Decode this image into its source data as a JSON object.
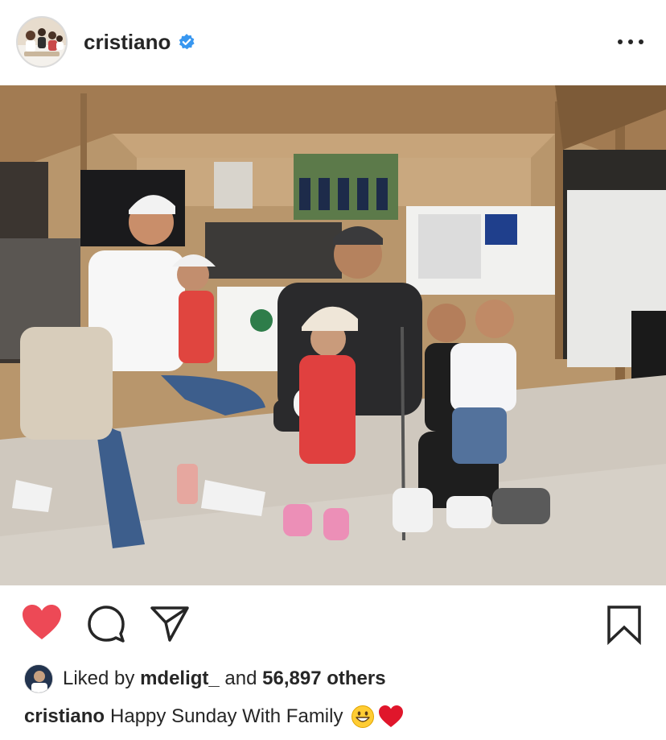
{
  "post": {
    "username": "cristiano",
    "verified": true,
    "icons": {
      "more": "more-horizontal-icon",
      "like": "heart-icon",
      "comment": "comment-bubble-icon",
      "share": "paper-plane-icon",
      "save": "bookmark-icon"
    },
    "liked": true,
    "colors": {
      "like_red": "#ed4956",
      "verified_blue": "#3897f0",
      "text": "#262626"
    }
  },
  "likes": {
    "prefix": "Liked by",
    "user": "mdeligt_",
    "conjunction": "and",
    "count": "56,897 others"
  },
  "caption": {
    "username": "cristiano",
    "text": "Happy Sunday With Family",
    "emojis": [
      "grinning-face-emoji",
      "red-heart-emoji"
    ]
  }
}
